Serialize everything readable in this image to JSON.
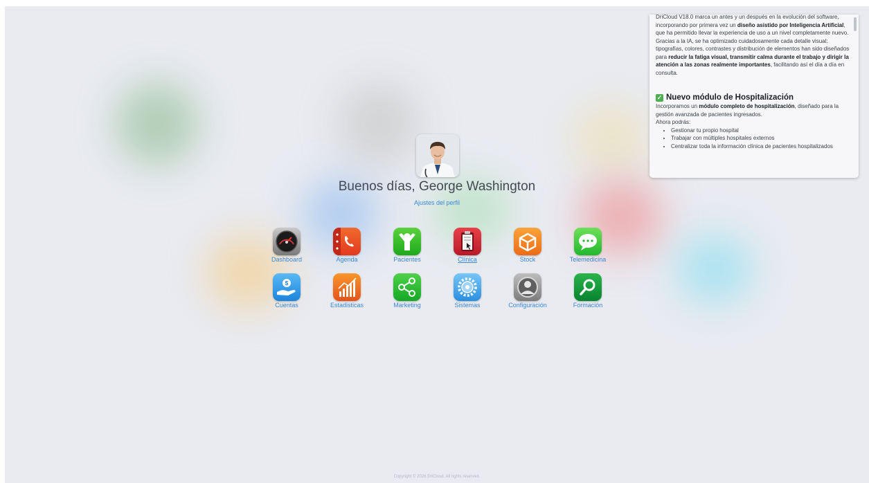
{
  "greeting": "Buenos días, George Washington",
  "profile_settings": "Ajustes del perfil",
  "apps": [
    {
      "label": "Dashboard",
      "icon": "speedometer-icon"
    },
    {
      "label": "Agenda",
      "icon": "phone-book-icon"
    },
    {
      "label": "Pacientes",
      "icon": "person-icon"
    },
    {
      "label": "Clínica",
      "icon": "clipboard-icon"
    },
    {
      "label": "Stock",
      "icon": "box-icon"
    },
    {
      "label": "Telemedicina",
      "icon": "chat-bubble-icon"
    },
    {
      "label": "Cuentas",
      "icon": "money-hand-icon"
    },
    {
      "label": "Estadisticas",
      "icon": "bar-chart-icon"
    },
    {
      "label": "Marketing",
      "icon": "share-icon"
    },
    {
      "label": "Sistemas",
      "icon": "gear-icon"
    },
    {
      "label": "Configuración",
      "icon": "user-settings-icon"
    },
    {
      "label": "Formación",
      "icon": "magnifier-icon"
    }
  ],
  "news": {
    "intro_line1_pre": "DriCloud V18.0 marca un antes y un después en la evolución del software, incorporando por primera vez un ",
    "intro_line1_bold": "diseño asistido por Inteligencia Artificial",
    "intro_line1_post": ", que ha permitido llevar la experiencia de uso a un nivel completamente nuevo.",
    "intro_line2_pre": "Gracias a la IA, se ha optimizado cuidadosamente cada detalle visual: tipografías, colores, contrastes y distribución de elementos han sido diseñados para ",
    "intro_line2_bold": "reducir la fatiga visual, transmitir calma durante el trabajo y dirigir la atención a las zonas realmente importantes",
    "intro_line2_post": ", facilitando así el día a día en consulta.",
    "title": "Nuevo módulo de Hospitalización",
    "body_pre": "Incorporamos un ",
    "body_bold": "módulo completo de hospitalización",
    "body_post": ", diseñado para la gestión avanzada de pacientes ingresados.",
    "now_you_can": "Ahora podrás:",
    "bullets": [
      "Gestionar tu propio hospital",
      "Trabajar con múltiples hospitales externos",
      "Centralizar toda la información clínica de pacientes hospitalizados"
    ]
  },
  "copyright": "Copyright © 2026 DriCloud. All rights reserved.",
  "colors": {
    "link": "#3b86d8",
    "background": "#e9ebf1"
  }
}
